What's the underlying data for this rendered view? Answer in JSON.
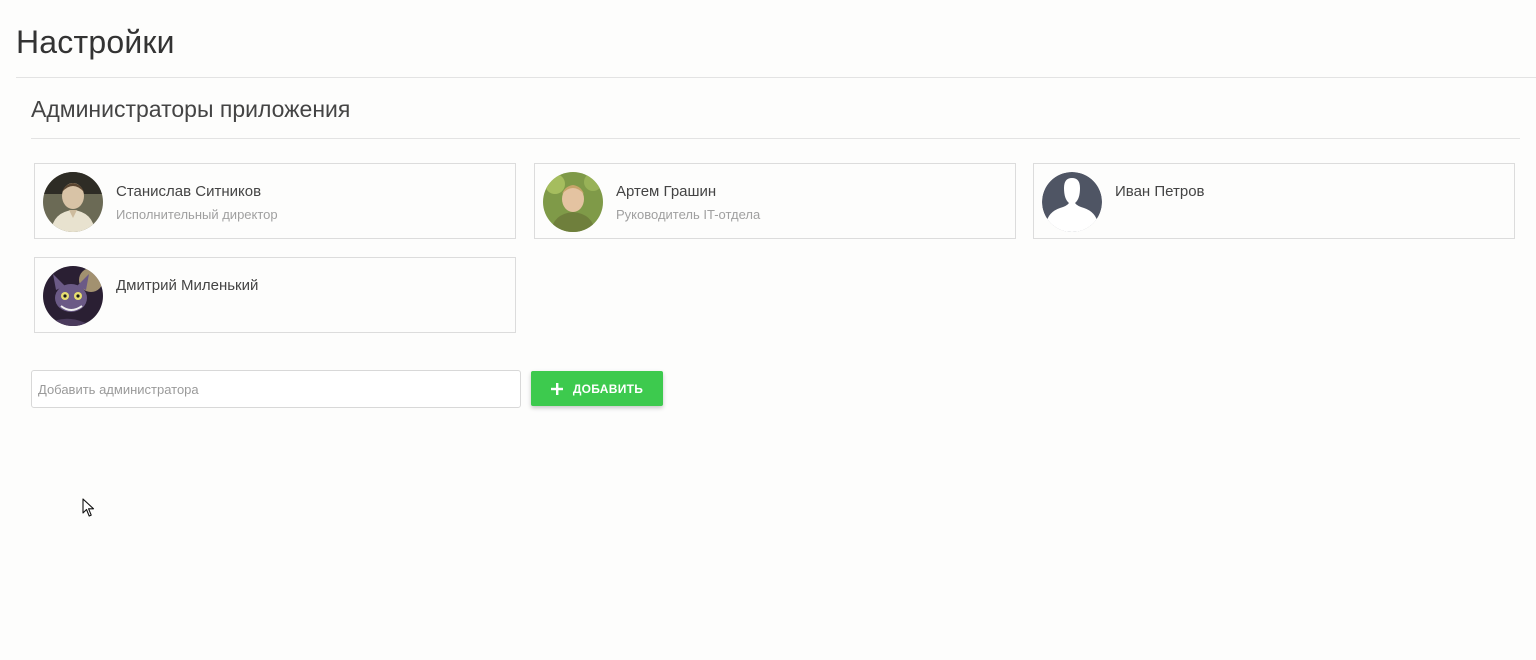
{
  "page": {
    "title": "Настройки"
  },
  "section": {
    "title": "Администраторы приложения"
  },
  "admins": [
    {
      "name": "Станислав Ситников",
      "role": "Исполнительный директор",
      "avatar": "photo"
    },
    {
      "name": "Артем Грашин",
      "role": "Руководитель IT-отдела",
      "avatar": "photo"
    },
    {
      "name": "Иван Петров",
      "role": "",
      "avatar": "default-silhouette"
    },
    {
      "name": "Дмитрий Миленький",
      "role": "",
      "avatar": "illustration"
    }
  ],
  "add_admin": {
    "placeholder": "Добавить администратора",
    "value": "",
    "button_label": "Добавить",
    "button_icon": "plus-icon"
  },
  "colors": {
    "accent": "#3dca4e",
    "border": "#dcdcdc",
    "muted_text": "#a0a0a0"
  }
}
